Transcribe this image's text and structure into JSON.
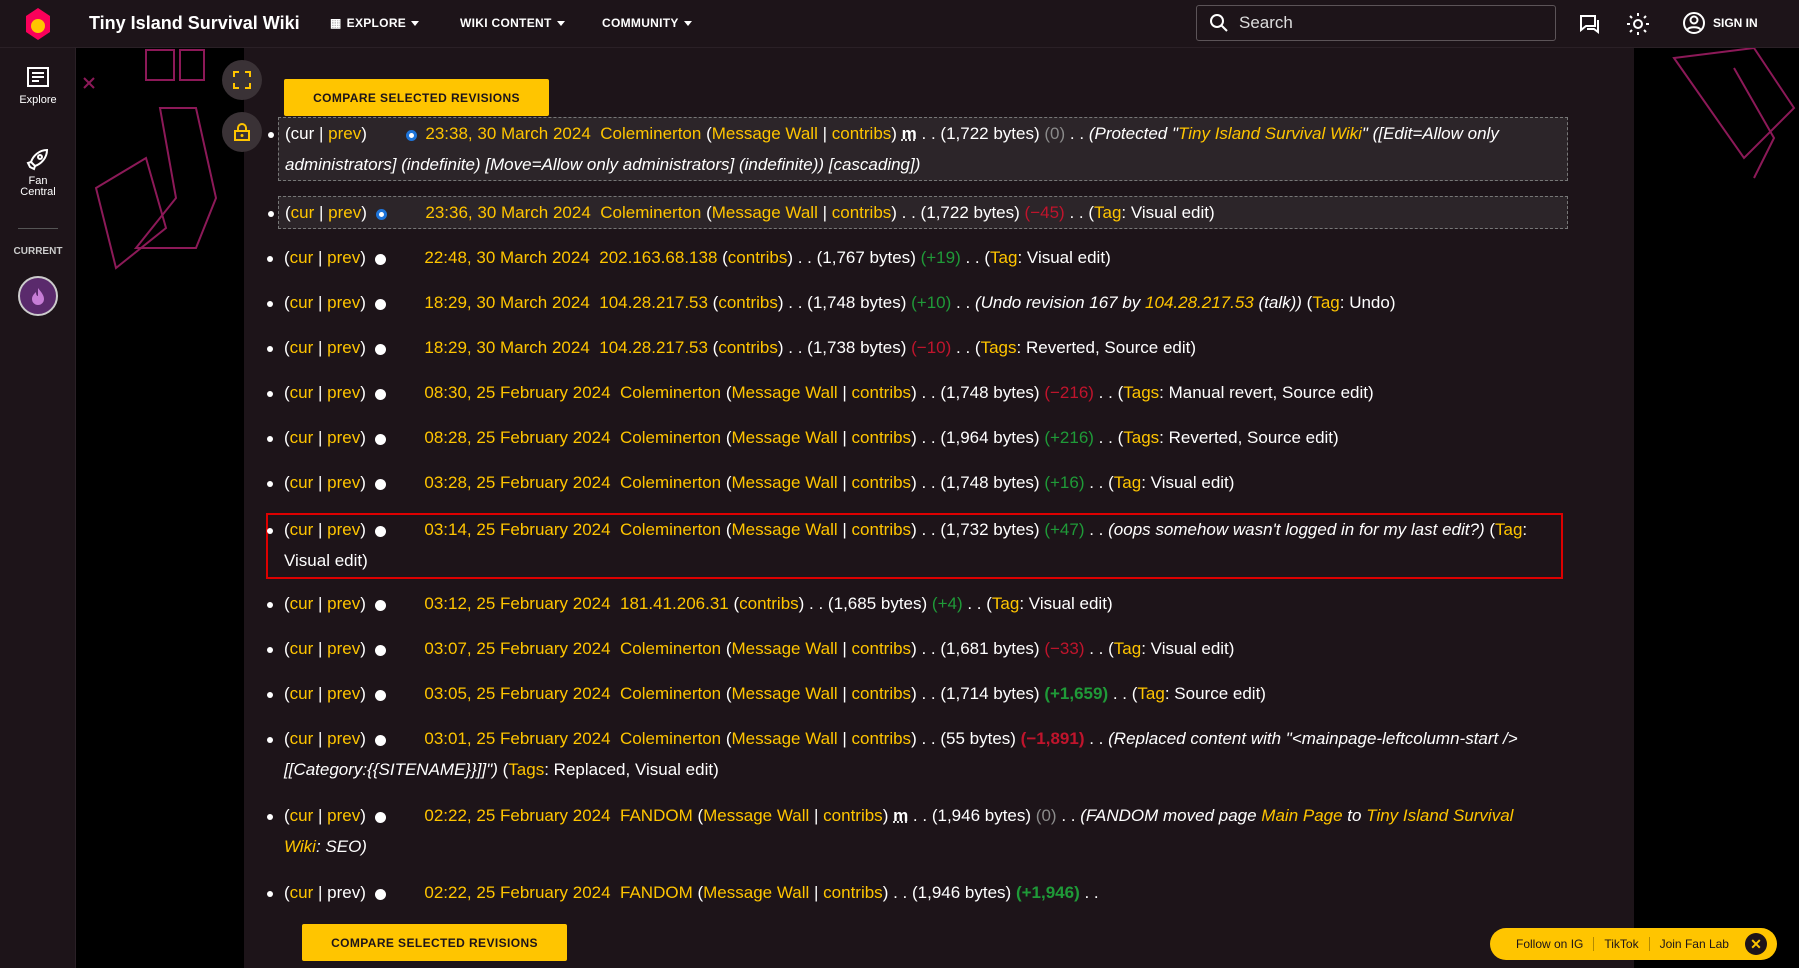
{
  "header": {
    "wiki_title": "Tiny Island Survival Wiki",
    "nav": [
      "EXPLORE",
      "WIKI CONTENT",
      "COMMUNITY"
    ],
    "search_placeholder": "Search",
    "sign_in": "SIGN IN"
  },
  "rail": {
    "explore": "Explore",
    "fan_central_1": "Fan",
    "fan_central_2": "Central",
    "current": "CURRENT"
  },
  "compare_button": "COMPARE SELECTED REVISIONS",
  "labels": {
    "cur": "cur",
    "prev": "prev",
    "message_wall": "Message Wall",
    "contribs": "contribs",
    "tag": "Tag",
    "tags": "Tags",
    "minor": "m"
  },
  "revisions": [
    {
      "time": "23:38, 30 March 2024",
      "user": "Coleminerton",
      "bytes": "1,722 bytes",
      "diff": "0"
    },
    {
      "time": "23:36, 30 March 2024",
      "user": "Coleminerton",
      "bytes": "1,722 bytes",
      "diff": "−45"
    },
    {
      "time": "22:48, 30 March 2024",
      "user": "202.163.68.138",
      "bytes": "1,767 bytes",
      "diff": "+19"
    },
    {
      "time": "18:29, 30 March 2024",
      "user": "104.28.217.53",
      "bytes": "1,748 bytes",
      "diff": "+10"
    },
    {
      "time": "18:29, 30 March 2024",
      "user": "104.28.217.53",
      "bytes": "1,738 bytes",
      "diff": "−10"
    },
    {
      "time": "08:30, 25 February 2024",
      "user": "Coleminerton",
      "bytes": "1,748 bytes",
      "diff": "−216"
    },
    {
      "time": "08:28, 25 February 2024",
      "user": "Coleminerton",
      "bytes": "1,964 bytes",
      "diff": "+216"
    },
    {
      "time": "03:28, 25 February 2024",
      "user": "Coleminerton",
      "bytes": "1,748 bytes",
      "diff": "+16"
    },
    {
      "time": "03:14, 25 February 2024",
      "user": "Coleminerton",
      "bytes": "1,732 bytes",
      "diff": "+47"
    },
    {
      "time": "03:12, 25 February 2024",
      "user": "181.41.206.31",
      "bytes": "1,685 bytes",
      "diff": "+4"
    },
    {
      "time": "03:07, 25 February 2024",
      "user": "Coleminerton",
      "bytes": "1,681 bytes",
      "diff": "−33"
    },
    {
      "time": "03:05, 25 February 2024",
      "user": "Coleminerton",
      "bytes": "1,714 bytes",
      "diff": "+1,659"
    },
    {
      "time": "03:01, 25 February 2024",
      "user": "Coleminerton",
      "bytes": "55 bytes",
      "diff": "−1,891"
    },
    {
      "time": "02:22, 25 February 2024",
      "user": "FANDOM",
      "bytes": "1,946 bytes",
      "diff": "0"
    },
    {
      "time": "02:22, 25 February 2024",
      "user": "FANDOM",
      "bytes": "1,946 bytes",
      "diff": "+1,946"
    }
  ],
  "summaries": {
    "r0_a": "(Protected \"",
    "r0_link": "Tiny Island Survival Wiki",
    "r0_b": "\" ([Edit=Allow only administrators] (indefinite) [Move=Allow only administrators] (indefinite)) [cascading])",
    "r3_a": "(Undo revision 167 by ",
    "r3_user": "104.28.217.53",
    "r3_talk": "(talk)",
    "r3_b": ")",
    "r8": "(oops somehow wasn't logged in for my last edit?)",
    "r12": "(Replaced content with \"<mainpage-leftcolumn-start /> [[Category:{{SITENAME}}]]\")",
    "r13_a": "(FANDOM moved page ",
    "r13_from": "Main Page",
    "r13_to_word": " to ",
    "r13_to": "Tiny Island Survival Wiki",
    "r13_b": ": SEO)"
  },
  "tag_values": {
    "visual_edit": "Visual edit",
    "undo": "Undo",
    "reverted_source": "Reverted, Source edit",
    "manual_revert_source": "Manual revert, Source edit",
    "source_edit": "Source edit",
    "replaced_visual": "Replaced, Visual edit"
  },
  "promo": [
    "Follow on IG",
    "TikTok",
    "Join Fan Lab"
  ],
  "colors": {
    "accent": "#ffc500",
    "positive": "#1f9a38",
    "negative": "#c0142c",
    "highlight_box": "#dd0000"
  }
}
